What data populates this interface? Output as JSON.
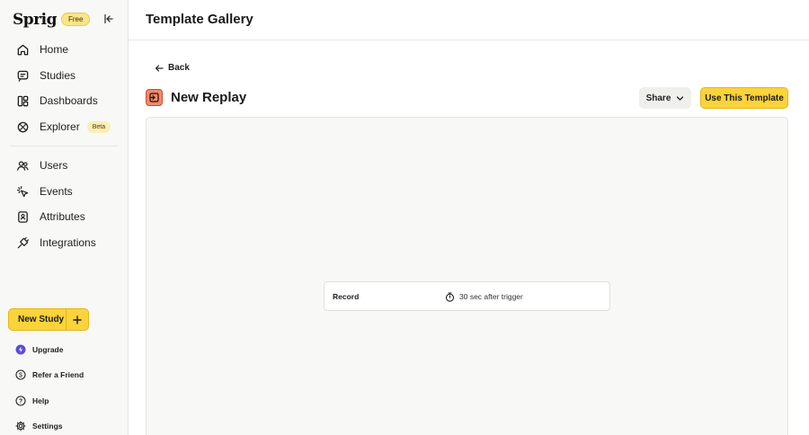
{
  "brand": {
    "name": "Sprig",
    "plan_badge": "Free"
  },
  "sidebar": {
    "primary": [
      {
        "label": "Home",
        "icon": "home-icon"
      },
      {
        "label": "Studies",
        "icon": "studies-icon"
      },
      {
        "label": "Dashboards",
        "icon": "dashboards-icon"
      },
      {
        "label": "Explorer",
        "icon": "explorer-icon",
        "badge": "Beta"
      }
    ],
    "secondary": [
      {
        "label": "Users",
        "icon": "users-icon"
      },
      {
        "label": "Events",
        "icon": "events-icon"
      },
      {
        "label": "Attributes",
        "icon": "attributes-icon"
      },
      {
        "label": "Integrations",
        "icon": "integrations-icon"
      }
    ],
    "new_study_label": "New Study",
    "footer": [
      {
        "label": "Upgrade",
        "icon": "upgrade-icon"
      },
      {
        "label": "Refer a Friend",
        "icon": "refer-icon"
      },
      {
        "label": "Help",
        "icon": "help-icon"
      },
      {
        "label": "Settings",
        "icon": "settings-icon"
      }
    ]
  },
  "header": {
    "title": "Template Gallery"
  },
  "main": {
    "back_label": "Back",
    "template_title": "New Replay",
    "share_label": "Share",
    "use_template_label": "Use This Template",
    "record_card": {
      "label": "Record",
      "timing": "30 sec after trigger"
    }
  },
  "colors": {
    "accent_yellow": "#fbd33a",
    "template_icon_bg": "#f08a6c",
    "upgrade_purple": "#5b4bd6"
  }
}
